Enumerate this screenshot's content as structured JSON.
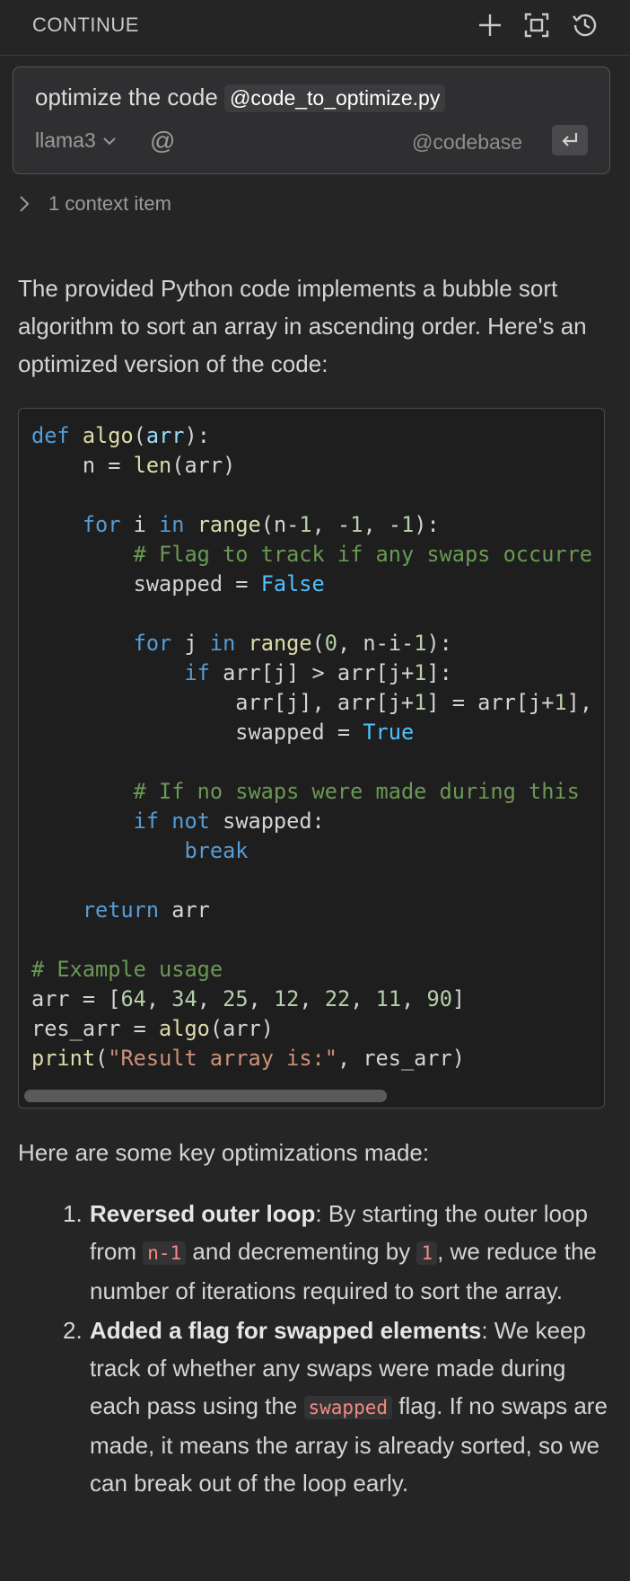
{
  "header": {
    "title": "CONTINUE"
  },
  "icons": {
    "new": "plus-icon",
    "fullscreen": "fullscreen-icon",
    "history": "history-icon"
  },
  "prompt": {
    "text": "optimize the code",
    "mention": "@code_to_optimize.py",
    "model": "llama3",
    "at_symbol": "@",
    "codebase": "@codebase"
  },
  "context": {
    "label": "1 context item"
  },
  "response": {
    "intro": "The provided Python code implements a bubble sort algorithm to sort an array in ascending order. Here's an optimized version of the code:",
    "optimizations_heading": "Here are some key optimizations made:",
    "items": [
      {
        "number": "1.",
        "title": "Reversed outer loop",
        "part1": ": By starting the outer loop from ",
        "code1": "n-1",
        "part2": " and decrementing by ",
        "code2": "1",
        "part3": ", we reduce the number of iterations required to sort the array."
      },
      {
        "number": "2.",
        "title": "Added a flag for swapped elements",
        "part1": ": We keep track of whether any swaps were made during each pass using the ",
        "code1": "swapped",
        "part2": " flag. If no swaps are made, it means the array is already sorted, so we can break out of the loop early."
      }
    ]
  },
  "code": {
    "lines": [
      "def algo(arr):",
      "    n = len(arr)",
      "",
      "    for i in range(n-1, -1, -1):",
      "        # Flag to track if any swaps occurre",
      "        swapped = False",
      "",
      "        for j in range(0, n-i-1):",
      "            if arr[j] > arr[j+1]:",
      "                arr[j], arr[j+1] = arr[j+1],",
      "                swapped = True",
      "",
      "        # If no swaps were made during this",
      "        if not swapped:",
      "            break",
      "",
      "    return arr",
      "",
      "# Example usage",
      "arr = [64, 34, 25, 12, 22, 11, 90]",
      "res_arr = algo(arr)",
      "print(\"Result array is:\", res_arr)"
    ]
  },
  "colors": {
    "background": "#252526",
    "code_background": "#1e1e1e",
    "keyword": "#569cd6",
    "function": "#dcdcaa",
    "number": "#b5cea8",
    "comment": "#6a9955",
    "string": "#ce9178",
    "inline_code": "#f28b82"
  }
}
